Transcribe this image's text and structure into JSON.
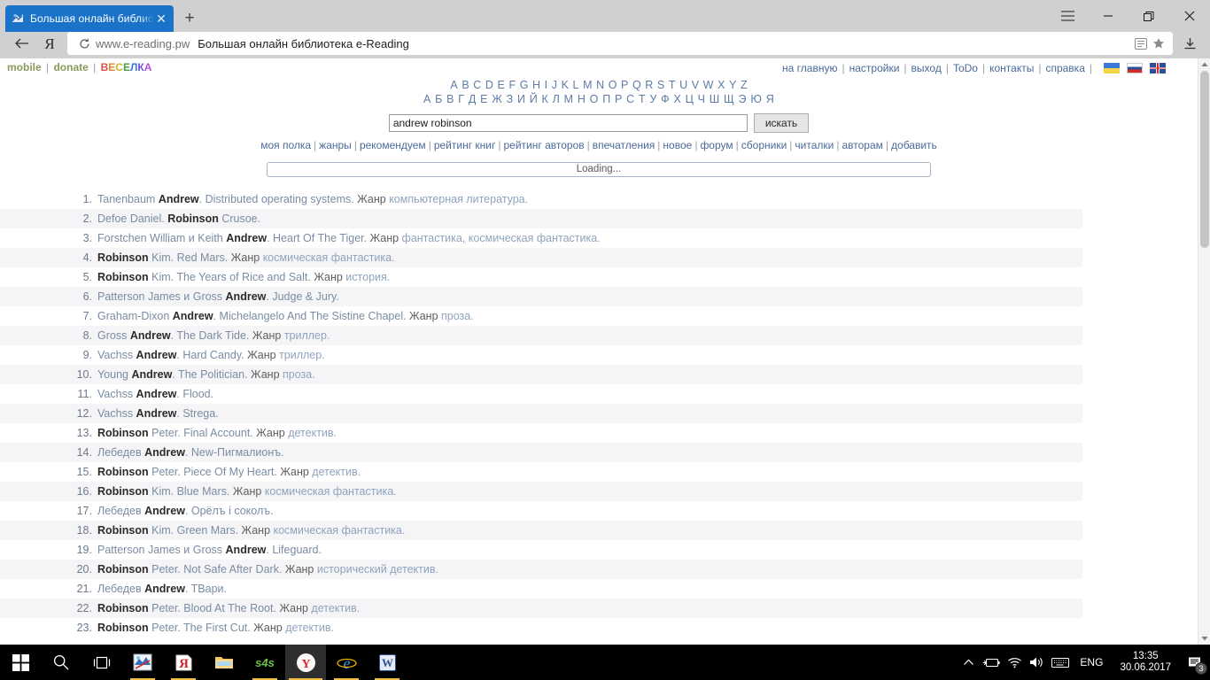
{
  "browser": {
    "tab_title": "Большая онлайн библио",
    "tab_close": "✕",
    "new_tab": "+",
    "url_host": "www.e-reading.pw",
    "url_title": "Большая онлайн библиотека e-Reading",
    "menu_icon": "hamburger-icon",
    "minimize": "—",
    "restore": "❐",
    "close": "✕"
  },
  "site": {
    "top_left": {
      "mobile": "mobile",
      "donate": "donate",
      "veselka": "ВЕСЕЛКА",
      "veselka_colors": [
        "#d94f4f",
        "#d98a2b",
        "#c9b52e",
        "#4a9e4a",
        "#3b7ad9",
        "#6b4fd9",
        "#b04fd9"
      ]
    },
    "top_right": [
      "на главную",
      "настройки",
      "выход",
      "ToDo",
      "контакты",
      "справка"
    ],
    "flags": [
      "flag-ua",
      "flag-ru",
      "flag-uk"
    ],
    "alphabet_latin": "A B C D E F G H I J K L M N O P Q R S T U V W X Y Z",
    "alphabet_cyrillic": "А Б В Г Д Е Ж З И Й К Л М Н О П Р С Т У Ф Х Ц Ч Ш Щ Э Ю Я",
    "search": {
      "value": "andrew robinson",
      "placeholder": "",
      "button": "искать"
    },
    "menu": [
      "моя полка",
      "жанры",
      "рекомендуем",
      "рейтинг книг",
      "рейтинг авторов",
      "впечатления",
      "новое",
      "форум",
      "сборники",
      "читалки",
      "авторам",
      "добавить"
    ],
    "loading": "Loading...",
    "genre_label": "Жанр"
  },
  "results": [
    {
      "n": "1.",
      "author": "Tanenbaum ",
      "match": "Andrew",
      "author_tail": ".",
      "title": " Distributed operating systems.",
      "genre": "компьютерная литература."
    },
    {
      "n": "2.",
      "author": "Defoe Daniel. ",
      "match": "Robinson",
      "author_tail": "",
      "title": " Crusoe.",
      "genre": ""
    },
    {
      "n": "3.",
      "author": "Forstchen William и Keith ",
      "match": "Andrew",
      "author_tail": ".",
      "title": " Heart Of The Tiger.",
      "genre": "фантастика, космическая фантастика."
    },
    {
      "n": "4.",
      "author": "",
      "match": "Robinson",
      "author_tail": " Kim.",
      "title": " Red Mars.",
      "genre": "космическая фантастика."
    },
    {
      "n": "5.",
      "author": "",
      "match": "Robinson",
      "author_tail": " Kim.",
      "title": " The Years of Rice and Salt.",
      "genre": "история."
    },
    {
      "n": "6.",
      "author": "Patterson James и Gross ",
      "match": "Andrew",
      "author_tail": ".",
      "title": " Judge & Jury.",
      "genre": ""
    },
    {
      "n": "7.",
      "author": "Graham-Dixon ",
      "match": "Andrew",
      "author_tail": ".",
      "title": " Michelangelo And The Sistine Chapel.",
      "genre": "проза."
    },
    {
      "n": "8.",
      "author": "Gross ",
      "match": "Andrew",
      "author_tail": ".",
      "title": " The Dark Tide.",
      "genre": "триллер."
    },
    {
      "n": "9.",
      "author": "Vachss ",
      "match": "Andrew",
      "author_tail": ".",
      "title": " Hard Candy.",
      "genre": "триллер."
    },
    {
      "n": "10.",
      "author": "Young ",
      "match": "Andrew",
      "author_tail": ".",
      "title": " The Politician.",
      "genre": "проза."
    },
    {
      "n": "11.",
      "author": "Vachss ",
      "match": "Andrew",
      "author_tail": ".",
      "title": " Flood.",
      "genre": ""
    },
    {
      "n": "12.",
      "author": "Vachss ",
      "match": "Andrew",
      "author_tail": ".",
      "title": " Strega.",
      "genre": ""
    },
    {
      "n": "13.",
      "author": "",
      "match": "Robinson",
      "author_tail": " Peter.",
      "title": " Final Account.",
      "genre": "детектив."
    },
    {
      "n": "14.",
      "author": "Лебедев ",
      "match": "Andrew",
      "author_tail": ".",
      "title": " New-Пигмалионъ.",
      "genre": ""
    },
    {
      "n": "15.",
      "author": "",
      "match": "Robinson",
      "author_tail": " Peter.",
      "title": " Piece Of My Heart.",
      "genre": "детектив."
    },
    {
      "n": "16.",
      "author": "",
      "match": "Robinson",
      "author_tail": " Kim.",
      "title": " Blue Mars.",
      "genre": "космическая фантастика."
    },
    {
      "n": "17.",
      "author": "Лебедев ",
      "match": "Andrew",
      "author_tail": ".",
      "title": " Орёлъ i соколъ.",
      "genre": ""
    },
    {
      "n": "18.",
      "author": "",
      "match": "Robinson",
      "author_tail": " Kim.",
      "title": " Green Mars.",
      "genre": "космическая фантастика."
    },
    {
      "n": "19.",
      "author": "Patterson James и Gross ",
      "match": "Andrew",
      "author_tail": ".",
      "title": " Lifeguard.",
      "genre": ""
    },
    {
      "n": "20.",
      "author": "",
      "match": "Robinson",
      "author_tail": " Peter.",
      "title": " Not Safe After Dark.",
      "genre": "исторический детектив."
    },
    {
      "n": "21.",
      "author": "Лебедев ",
      "match": "Andrew",
      "author_tail": ".",
      "title": " TBари.",
      "genre": ""
    },
    {
      "n": "22.",
      "author": "",
      "match": "Robinson",
      "author_tail": " Peter.",
      "title": " Blood At The Root.",
      "genre": "детектив."
    },
    {
      "n": "23.",
      "author": "",
      "match": "Robinson",
      "author_tail": " Peter.",
      "title": " The First Cut.",
      "genre": "детектив."
    }
  ],
  "taskbar": {
    "icons": [
      "windows-start-icon",
      "search-icon",
      "task-view-icon",
      "paint-icon",
      "yandex-disk-icon",
      "file-explorer-icon",
      "sims4-icon",
      "yandex-browser-icon",
      "internet-explorer-icon",
      "word-icon"
    ],
    "tray": {
      "chevron": "⌃",
      "battery": "battery-icon",
      "wifi": "wifi-icon",
      "volume": "volume-icon",
      "keyboard": "keyboard-icon",
      "language": "ENG",
      "time": "13:35",
      "date": "30.06.2017",
      "notifications": "3"
    }
  }
}
